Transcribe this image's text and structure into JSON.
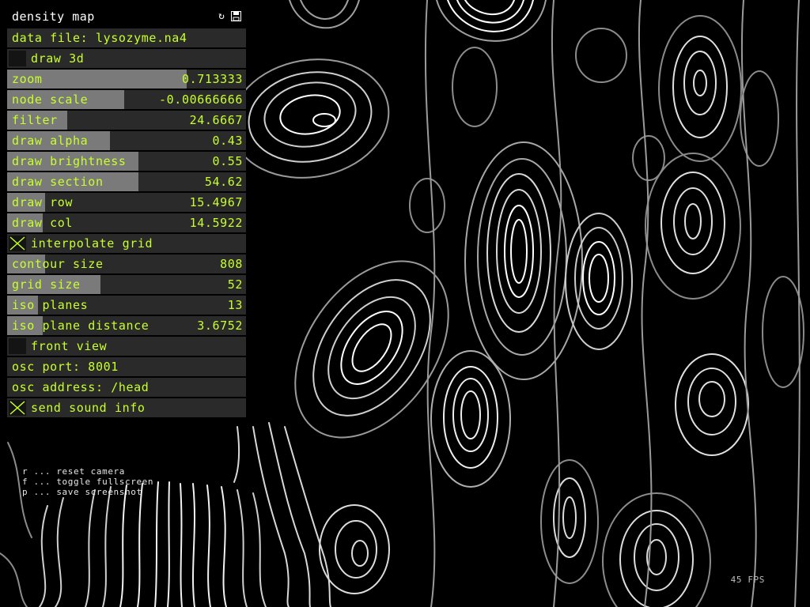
{
  "panel": {
    "title": "density map",
    "header_icons": [
      "refresh-icon",
      "save-icon"
    ],
    "controls": [
      {
        "kind": "text",
        "name": "data-file-label",
        "label": "data file: lysozyme.na4"
      },
      {
        "kind": "toggle",
        "name": "draw-3d-toggle",
        "label": "draw 3d",
        "checked": false
      },
      {
        "kind": "slider",
        "name": "zoom-slider",
        "label": "zoom",
        "value": "0.713333",
        "fill": 0.75
      },
      {
        "kind": "slider",
        "name": "node-scale-slider",
        "label": "node scale",
        "value": "-0.00666666",
        "fill": 0.49
      },
      {
        "kind": "slider",
        "name": "filter-slider",
        "label": "filter",
        "value": "24.6667",
        "fill": 0.25
      },
      {
        "kind": "slider",
        "name": "draw-alpha-slider",
        "label": "draw alpha",
        "value": "0.43",
        "fill": 0.43
      },
      {
        "kind": "slider",
        "name": "draw-brightness-slider",
        "label": "draw brightness",
        "value": "0.55",
        "fill": 0.55
      },
      {
        "kind": "slider",
        "name": "draw-section-slider",
        "label": "draw section",
        "value": "54.62",
        "fill": 0.55
      },
      {
        "kind": "slider",
        "name": "draw-row-slider",
        "label": "draw row",
        "value": "15.4967",
        "fill": 0.16
      },
      {
        "kind": "slider",
        "name": "draw-col-slider",
        "label": "draw col",
        "value": "14.5922",
        "fill": 0.15
      },
      {
        "kind": "toggle",
        "name": "interpolate-grid-toggle",
        "label": "interpolate grid",
        "checked": true
      },
      {
        "kind": "slider",
        "name": "contour-size-slider",
        "label": "contour size",
        "value": "808",
        "fill": 0.16
      },
      {
        "kind": "slider",
        "name": "grid-size-slider",
        "label": "grid size",
        "value": "52",
        "fill": 0.39
      },
      {
        "kind": "slider",
        "name": "iso-planes-slider",
        "label": "iso planes",
        "value": "13",
        "fill": 0.13
      },
      {
        "kind": "slider",
        "name": "iso-plane-distance-slider",
        "label": "iso plane distance",
        "value": "3.6752",
        "fill": 0.15
      },
      {
        "kind": "toggle",
        "name": "front-view-toggle",
        "label": "front view",
        "checked": false
      },
      {
        "kind": "text",
        "name": "osc-port-field",
        "label": "osc port: 8001"
      },
      {
        "kind": "text",
        "name": "osc-address-field",
        "label": "osc address: /head"
      },
      {
        "kind": "toggle",
        "name": "send-sound-info-toggle",
        "label": "send sound info",
        "checked": true
      }
    ]
  },
  "help": [
    "r ... reset camera",
    "f ... toggle fullscreen",
    "p ... save screenshot"
  ],
  "fps": "45 FPS",
  "colors": {
    "accent": "#c8ff2a",
    "row_bg": "#2a2a2a",
    "fill": "#7a7a7a",
    "background": "#000000"
  }
}
